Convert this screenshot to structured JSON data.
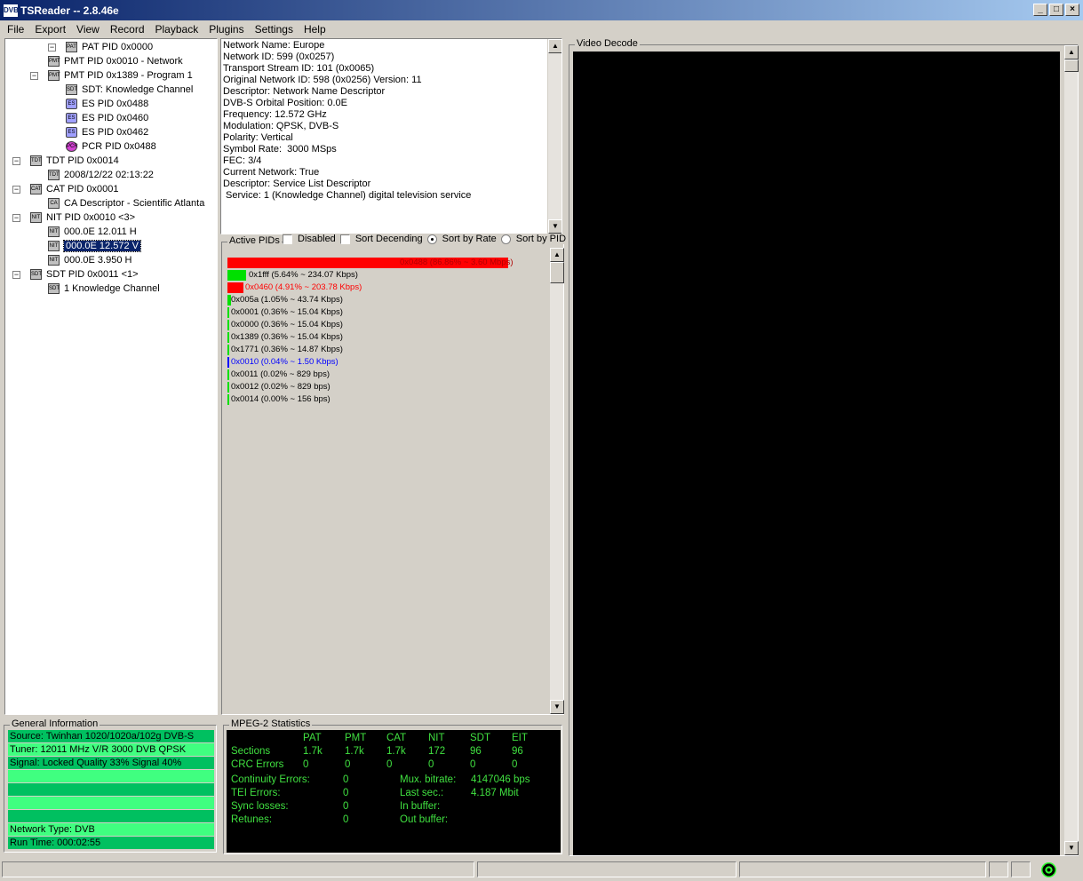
{
  "window": {
    "logo": "DVB",
    "title": "TSReader -- 2.8.46e",
    "buttons": [
      "_",
      "□",
      "×"
    ]
  },
  "menu": [
    "File",
    "Export",
    "View",
    "Record",
    "Playback",
    "Plugins",
    "Settings",
    "Help"
  ],
  "tree": [
    {
      "label": "PAT PID 0x0000",
      "toggle": "−",
      "icon": "PAT"
    },
    {
      "label": "PMT PID 0x0010 - Network",
      "toggle": "",
      "icon": "PMT"
    },
    {
      "label": "PMT PID 0x1389 - Program 1",
      "toggle": "−",
      "icon": "PMT"
    },
    {
      "label": "SDT: Knowledge Channel",
      "toggle": "",
      "icon": "SDT"
    },
    {
      "label": "ES PID 0x0488",
      "toggle": "",
      "icon": "ES"
    },
    {
      "label": "ES PID 0x0460",
      "toggle": "",
      "icon": "ES"
    },
    {
      "label": "ES PID 0x0462",
      "toggle": "",
      "icon": "ES"
    },
    {
      "label": "PCR PID 0x0488",
      "toggle": "",
      "icon": "PCR"
    },
    {
      "label": "TDT PID 0x0014",
      "toggle": "−",
      "icon": "TDT"
    },
    {
      "label": "2008/12/22 02:13:22",
      "toggle": "",
      "icon": "TDT"
    },
    {
      "label": "CAT PID 0x0001",
      "toggle": "−",
      "icon": "CAT"
    },
    {
      "label": "CA Descriptor - Scientific Atlanta",
      "toggle": "",
      "icon": "CA"
    },
    {
      "label": "NIT PID 0x0010 <3>",
      "toggle": "−",
      "icon": "NIT"
    },
    {
      "label": "000.0E 12.011 H",
      "toggle": "",
      "icon": "NIT"
    },
    {
      "label": "000.0E 12.572 V",
      "toggle": "",
      "icon": "NIT"
    },
    {
      "label": "000.0E 3.950 H",
      "toggle": "",
      "icon": "NIT"
    },
    {
      "label": "SDT PID 0x0011 <1>",
      "toggle": "−",
      "icon": "SDT"
    },
    {
      "label": "1 Knowledge Channel",
      "toggle": "",
      "icon": "SDT"
    }
  ],
  "info_lines": [
    "Network Name: Europe",
    "Network ID: 599 (0x0257)",
    "Transport Stream ID: 101 (0x0065)",
    "Original Network ID: 598 (0x0256) Version: 11",
    "Descriptor: Network Name Descriptor",
    "DVB-S Orbital Position: 0.0E",
    "Frequency: 12.572 GHz",
    "Modulation: QPSK, DVB-S",
    "Polarity: Vertical",
    "Symbol Rate:  3000 MSps",
    "FEC: 3/4",
    "Current Network: True",
    "Descriptor: Service List Descriptor",
    " Service: 1 (Knowledge Channel) digital television service"
  ],
  "pids": {
    "title": "Active PIDs",
    "options": {
      "disabled": "Disabled",
      "sort_desc": "Sort Decending",
      "sort_rate": "Sort by Rate",
      "sort_pid": "Sort by PID"
    },
    "colors": {
      "red": "#ff0000",
      "green": "#00e000",
      "blue": "#0000ff"
    },
    "rows": [
      {
        "label": "0x0488 (86.86% ~ 3.60 Mbps)",
        "fraction": 0.8686,
        "bar_color": "#ff0000",
        "text_color": "#b00000"
      },
      {
        "label": "0x1fff (5.64% ~ 234.07 Kbps)",
        "fraction": 0.0564,
        "bar_color": "#00e000",
        "text_color": "#000000"
      },
      {
        "label": "0x0460 (4.91% ~ 203.78 Kbps)",
        "fraction": 0.0491,
        "bar_color": "#ff0000",
        "text_color": "#ff0000"
      },
      {
        "label": "0x005a (1.05% ~ 43.74 Kbps)",
        "fraction": 0.0105,
        "bar_color": "#00e000",
        "text_color": "#000000"
      },
      {
        "label": "0x0001 (0.36% ~ 15.04 Kbps)",
        "fraction": 0.0036,
        "bar_color": "#00e000",
        "text_color": "#000000"
      },
      {
        "label": "0x0000 (0.36% ~ 15.04 Kbps)",
        "fraction": 0.0036,
        "bar_color": "#00e000",
        "text_color": "#000000"
      },
      {
        "label": "0x1389 (0.36% ~ 15.04 Kbps)",
        "fraction": 0.0036,
        "bar_color": "#00e000",
        "text_color": "#000000"
      },
      {
        "label": "0x1771 (0.36% ~ 14.87 Kbps)",
        "fraction": 0.0036,
        "bar_color": "#00e000",
        "text_color": "#000000"
      },
      {
        "label": "0x0010 (0.04% ~ 1.50 Kbps)",
        "fraction": 0.0004,
        "bar_color": "#0000ff",
        "text_color": "#0000ff"
      },
      {
        "label": "0x0011 (0.02% ~ 829 bps)",
        "fraction": 0.0002,
        "bar_color": "#00e000",
        "text_color": "#000000"
      },
      {
        "label": "0x0012 (0.02% ~ 829 bps)",
        "fraction": 0.0002,
        "bar_color": "#00e000",
        "text_color": "#000000"
      },
      {
        "label": "0x0014 (0.00% ~ 156 bps)",
        "fraction": 0.0,
        "bar_color": "#00e000",
        "text_color": "#000000"
      }
    ]
  },
  "video": {
    "title": "Video Decode"
  },
  "general": {
    "title": "General Information",
    "rows": [
      "Source: Twinhan 1020/1020a/102g DVB-S",
      "Tuner: 12011 MHz V/R 3000 DVB QPSK",
      "Signal: Locked Quality 33% Signal 40%",
      "",
      "",
      "",
      "",
      "Network Type: DVB",
      "Run Time: 000:02:55"
    ]
  },
  "mpeg": {
    "title": "MPEG-2 Statistics",
    "headers": [
      "PAT",
      "PMT",
      "CAT",
      "NIT",
      "SDT",
      "EIT"
    ],
    "sections_label": "Sections",
    "sections": [
      "1.7k",
      "1.7k",
      "1.7k",
      "172",
      "96",
      "96"
    ],
    "crc_label": "CRC Errors",
    "crc": [
      "0",
      "0",
      "0",
      "0",
      "0",
      "0"
    ],
    "left_stats": [
      {
        "label": "Continuity Errors:",
        "value": "0"
      },
      {
        "label": "TEI Errors:",
        "value": "0"
      },
      {
        "label": "Sync losses:",
        "value": "0"
      },
      {
        "label": "Retunes:",
        "value": "0"
      }
    ],
    "right_stats": [
      {
        "label": "Mux. bitrate:",
        "value": "4147046 bps"
      },
      {
        "label": "Last sec.:",
        "value": "4.187 Mbit"
      },
      {
        "label": "In buffer:",
        "value": ""
      },
      {
        "label": "Out buffer:",
        "value": ""
      }
    ]
  }
}
